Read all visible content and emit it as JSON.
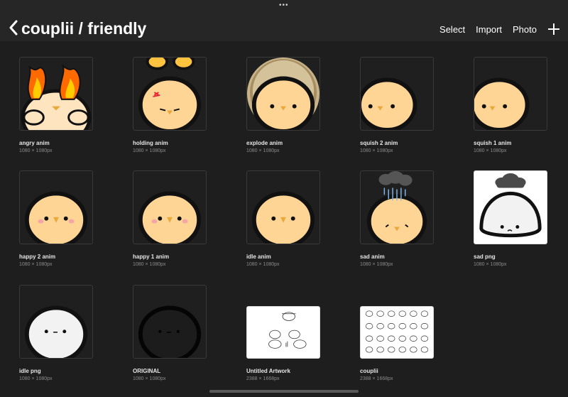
{
  "header": {
    "title": "couplii / friendly",
    "actions": {
      "select": "Select",
      "import": "Import",
      "photo": "Photo"
    }
  },
  "icons": {
    "back": "chevron-left-icon",
    "add": "plus-icon",
    "handle": "more-dots-icon"
  },
  "colors": {
    "background": "#1e1e1e",
    "topbar": "#262626",
    "chick": "#ffd596",
    "beak": "#e8a83a",
    "blush": "#f4a6a6"
  },
  "gallery": [
    {
      "name": "angry anim",
      "size": "1080 × 1080px"
    },
    {
      "name": "holding anim",
      "size": "1080 × 1080px"
    },
    {
      "name": "explode anim",
      "size": "1080 × 1080px"
    },
    {
      "name": "squish 2 anim",
      "size": "1080 × 1080px"
    },
    {
      "name": "squish 1 anim",
      "size": "1080 × 1080px"
    },
    {
      "name": "happy 2 anim",
      "size": "1080 × 1080px"
    },
    {
      "name": "happy 1 anim",
      "size": "1080 × 1080px"
    },
    {
      "name": "idle anim",
      "size": "1080 × 1080px"
    },
    {
      "name": "sad anim",
      "size": "1080 × 1080px"
    },
    {
      "name": "sad png",
      "size": "1080 × 1080px"
    },
    {
      "name": "idle png",
      "size": "1080 × 1080px"
    },
    {
      "name": "ORIGINAL",
      "size": "1080 × 1080px"
    },
    {
      "name": "Untitled Artwork",
      "size": "2388 × 1668px"
    },
    {
      "name": "couplii",
      "size": "2388 × 1668px"
    }
  ]
}
